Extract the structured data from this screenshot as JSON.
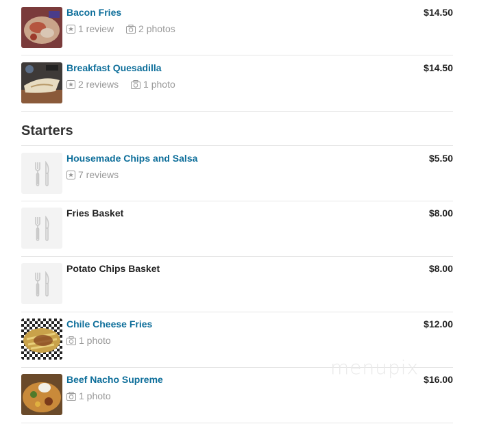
{
  "items_top": [
    {
      "name": "Bacon Fries",
      "price": "$14.50",
      "reviews": "1 review",
      "photos": "2 photos",
      "thumb": "bacon-fries-photo"
    },
    {
      "name": "Breakfast Quesadilla",
      "price": "$14.50",
      "reviews": "2 reviews",
      "photos": "1 photo",
      "thumb": "quesadilla-photo"
    }
  ],
  "section": {
    "title": "Starters"
  },
  "starters": [
    {
      "name": "Housemade Chips and Salsa",
      "price": "$5.50",
      "reviews": "7 reviews"
    },
    {
      "name": "Fries Basket",
      "price": "$8.00"
    },
    {
      "name": "Potato Chips Basket",
      "price": "$8.00"
    },
    {
      "name": "Chile Cheese Fries",
      "price": "$12.00",
      "photos": "1 photo",
      "thumb": "chile-cheese-fries-photo"
    },
    {
      "name": "Beef Nacho Supreme",
      "price": "$16.00",
      "photos": "1 photo",
      "thumb": "nacho-photo"
    }
  ],
  "watermark": "menupix",
  "colors": {
    "link": "#0d6e9a",
    "meta": "#999999",
    "divider": "#e6e6e6",
    "placeholder_bg": "#f3f3f3"
  }
}
